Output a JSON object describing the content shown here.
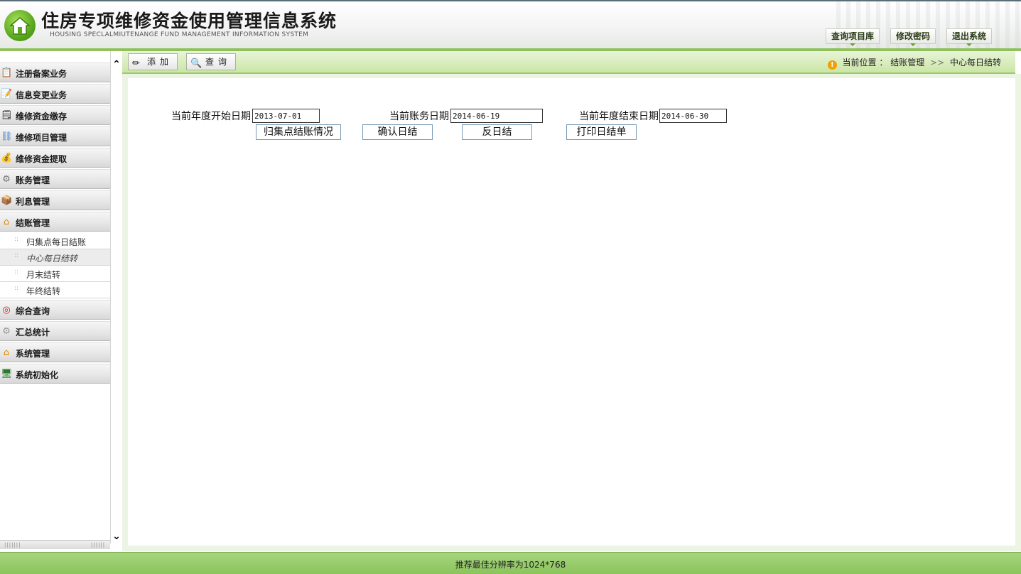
{
  "header": {
    "title": "住房专项维修资金使用管理信息系统",
    "subtitle": "HOUSING SPECLALMIUTENANGE FUND MANAGEMENT INFORMATION SYSTEM",
    "buttons": {
      "query_project": "查询项目库",
      "change_password": "修改密码",
      "logout": "退出系统"
    }
  },
  "toolbar": {
    "add_label": "添加",
    "query_label": "查询"
  },
  "breadcrumb": {
    "prefix": "当前位置 ：",
    "section": "结账管理",
    "separator": ">>",
    "page": "中心每日结转"
  },
  "sidebar": {
    "items": [
      {
        "label": "注册备案业务",
        "icon": "clipboard-icon"
      },
      {
        "label": "信息变更业务",
        "icon": "document-edit-icon"
      },
      {
        "label": "维修资金缴存",
        "icon": "notepad-icon"
      },
      {
        "label": "维修项目管理",
        "icon": "network-icon"
      },
      {
        "label": "维修资金提取",
        "icon": "coins-icon"
      },
      {
        "label": "账务管理",
        "icon": "gear-icon"
      },
      {
        "label": "利息管理",
        "icon": "box-icon"
      },
      {
        "label": "结账管理",
        "icon": "house-icon"
      },
      {
        "label": "综合查询",
        "icon": "lifebuoy-icon"
      },
      {
        "label": "汇总统计",
        "icon": "gear-lock-icon"
      },
      {
        "label": "系统管理",
        "icon": "house-icon"
      },
      {
        "label": "系统初始化",
        "icon": "monitor-icon"
      }
    ],
    "submenu": [
      {
        "label": "归集点每日结账"
      },
      {
        "label": "中心每日结转"
      },
      {
        "label": "月末结转"
      },
      {
        "label": "年终结转"
      }
    ]
  },
  "form": {
    "start_date_label": "当前年度开始日期",
    "start_date_value": "2013-07-01",
    "account_date_label": "当前账务日期",
    "account_date_value": "2014-06-19",
    "end_date_label": "当前年度结束日期",
    "end_date_value": "2014-06-30",
    "buttons": {
      "collection_status": "归集点结账情况",
      "confirm_daily": "确认日结",
      "reverse_daily": "反日结",
      "print_daily": "打印日结单"
    }
  },
  "footer": {
    "text": "推荐最佳分辨率为1024*768"
  },
  "colors": {
    "accent_green": "#8fc15a",
    "toolbar_green": "#cbe6a6",
    "warning": "#f0a000"
  }
}
